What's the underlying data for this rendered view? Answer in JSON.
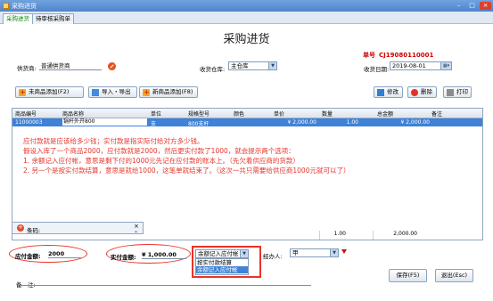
{
  "window": {
    "title": "采购进货",
    "min": "–",
    "max": "□",
    "close": "×"
  },
  "tabs": [
    {
      "label": "采购进货"
    },
    {
      "label": "待审核采购单"
    }
  ],
  "page_title": "采购进货",
  "order": {
    "label": "单号",
    "value": "CJ19080110001"
  },
  "supplier": {
    "label": "供货商:",
    "value": "普通供货商"
  },
  "warehouse": {
    "label": "收货仓库:",
    "value": "主仓库"
  },
  "date": {
    "label": "收货日期:",
    "value": "2019-08-01"
  },
  "toolbar": {
    "add_product": "未商品添加(F2)",
    "import_export": "导入・导出",
    "new_product": "新商品添加(F8)",
    "edit": "修改",
    "delete": "删除",
    "print": "打印"
  },
  "grid": {
    "columns": [
      "商品编号",
      "商品名称",
      "单位",
      "规格型号",
      "颜色",
      "单价",
      "数量",
      "总金额",
      "备注"
    ],
    "rows": [
      {
        "code": "11000003",
        "name": "锅杆外开800",
        "unit": "支",
        "spec": "800支杆",
        "color": "",
        "price": "¥ 2,000.00",
        "qty": "1.00",
        "total": "¥ 2,000.00",
        "note": ""
      }
    ]
  },
  "annotation": [
    "应付款就是应该给多少钱；实付款是指实际付给对方多少钱。",
    "假设入库了一个商品2000，应付款就是2000，然后更实付款了1000，就会提示两个选项：",
    "1. 余额记入应付帐，意思是剩下付的1000元先记在应付款的账本上。（先欠着供应商的货款）",
    "2. 另一个是按实付款结算，意思是就给1000，这笔单就结束了。（这次一共只需要给供应商1000元就可以了）"
  ],
  "barcode": {
    "label": "条码:",
    "clear": "×",
    "expand": "⌄"
  },
  "summary": {
    "qty": "1.00",
    "total": "2,000.00"
  },
  "payable": {
    "label": "应付金额:",
    "value": "2000"
  },
  "paid": {
    "label": "实付金额:",
    "value": "¥ 1,000.00"
  },
  "settlement": {
    "value": "余额记入应付帐",
    "options": [
      "按实付款结算",
      "余额记入应付帐"
    ]
  },
  "handler": {
    "label": "经办人:",
    "value": "甲"
  },
  "save_button": "保存(F5)",
  "exit_button": "退出(Esc)",
  "memo": {
    "label": "备　注:"
  },
  "colors": {
    "accent": "#3f82d6",
    "annotation": "#e8342a",
    "order_no": "#d00000"
  }
}
